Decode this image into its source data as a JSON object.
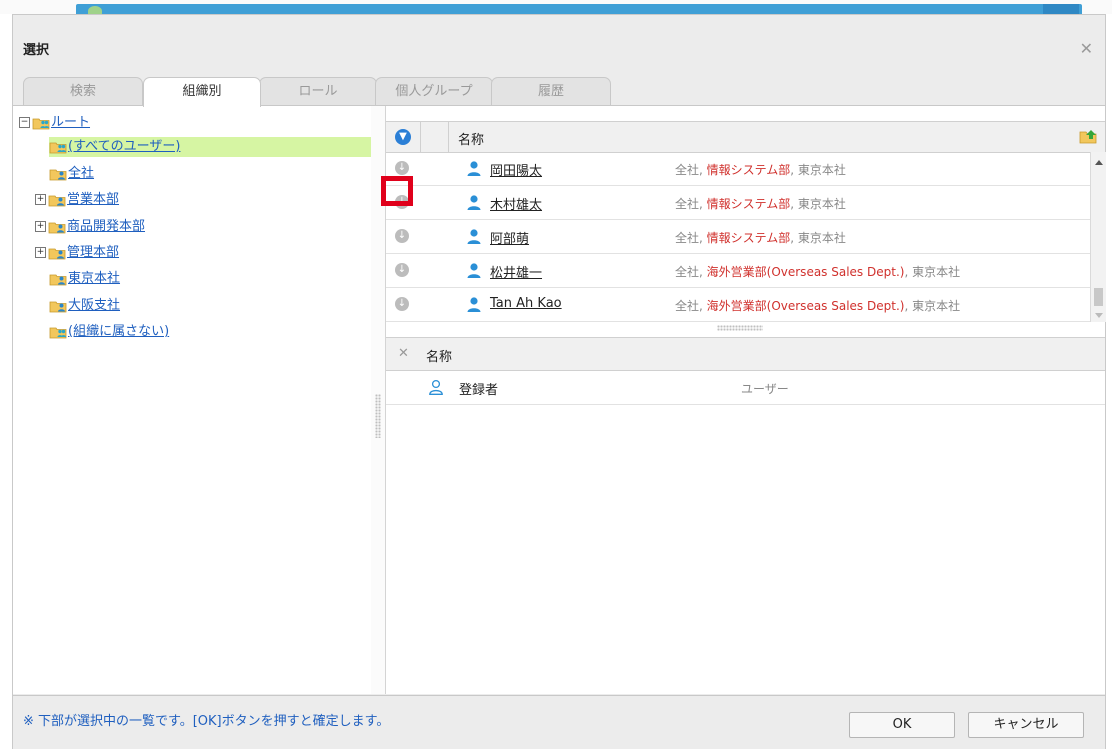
{
  "dialog": {
    "title": "選択",
    "close_icon": "close-icon"
  },
  "tabs": [
    {
      "label": "検索",
      "active": false
    },
    {
      "label": "組織別",
      "active": true
    },
    {
      "label": "ロール",
      "active": false
    },
    {
      "label": "個人グループ",
      "active": false
    },
    {
      "label": "履歴",
      "active": false
    }
  ],
  "tree": {
    "root": "ルート",
    "items": [
      {
        "label": "(すべてのユーザー)",
        "selected": true,
        "icon": "group-folder-icon"
      },
      {
        "label": "全社",
        "icon": "org-folder-icon"
      },
      {
        "label": "営業本部",
        "expandable": true,
        "icon": "org-folder-icon"
      },
      {
        "label": "商品開発本部",
        "expandable": true,
        "icon": "org-folder-icon"
      },
      {
        "label": "管理本部",
        "expandable": true,
        "icon": "org-folder-icon"
      },
      {
        "label": "東京本社",
        "icon": "org-folder-icon"
      },
      {
        "label": "大阪支社",
        "icon": "org-folder-icon"
      },
      {
        "label": "(組織に属さない)",
        "icon": "group-folder-icon"
      }
    ]
  },
  "user_grid": {
    "header_label": "名称",
    "rows": [
      {
        "name": "岡田陽太",
        "org_prefix": "全社, ",
        "dept": "情報システム部",
        "org_suffix": ", 東京本社"
      },
      {
        "name": "木村雄太",
        "org_prefix": "全社, ",
        "dept": "情報システム部",
        "org_suffix": ", 東京本社"
      },
      {
        "name": "阿部萌",
        "org_prefix": "全社, ",
        "dept": "情報システム部",
        "org_suffix": ", 東京本社"
      },
      {
        "name": "松井雄一",
        "org_prefix": "全社, ",
        "dept": "海外営業部(Overseas Sales Dept.)",
        "org_suffix": ", 東京本社"
      },
      {
        "name": "Tan Ah Kao",
        "org_prefix": "全社, ",
        "dept": "海外営業部(Overseas Sales Dept.)",
        "org_suffix": ", 東京本社"
      }
    ]
  },
  "selected_grid": {
    "header_label": "名称",
    "rows": [
      {
        "name": "登録者",
        "type": "ユーザー"
      }
    ]
  },
  "footer": {
    "note": "※ 下部が選択中の一覧です。[OK]ボタンを押すと確定します。",
    "ok_label": "OK",
    "cancel_label": "キャンセル"
  },
  "colors": {
    "tree_selected_bg": "#d6f5a3",
    "dept_red": "#d0312d",
    "link_blue": "#1f5fbf",
    "highlight_red": "#e0001b"
  }
}
